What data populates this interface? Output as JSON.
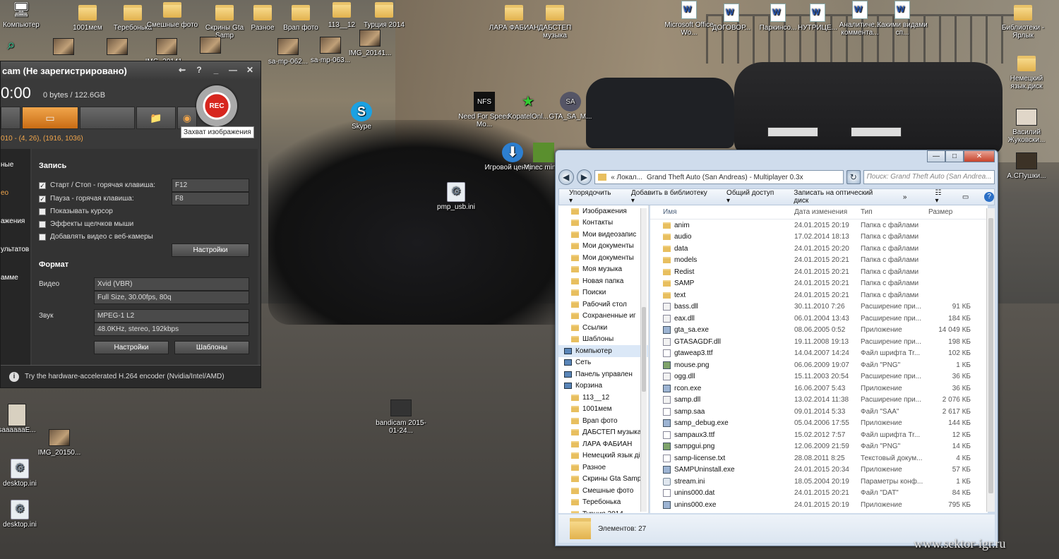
{
  "desktop": {
    "top_icons": [
      "Компьютер",
      "1001мем",
      "Теребонька",
      "Смешные фото",
      "Скрины Gta Samp",
      "Разное",
      "Врап фото",
      "113__12",
      "Турция 2014",
      "ЛАРА ФАБИАН",
      "ДАБСТЕП музыка",
      "Microsoft Office Wo...",
      "ДОГОВОР...",
      "Паркинсо...",
      "НУТРИЦЕ...",
      "Аналитиче... коммента...",
      "Какими видами сп...",
      "Библиотеки - Ярлык"
    ],
    "row2": [
      "IMG_20141...",
      "sa-mp-062...",
      "sa-mp-063...",
      "IMG_20141..."
    ],
    "mid_icons": [
      "Skype",
      "Need For Speed Mo...",
      "KopatelOnl...",
      "GTA_SA_M...",
      "Игровой центр ...",
      "Minec minec",
      "pmp_usb.ini"
    ],
    "right_icons": [
      "Немецкий язык.диск",
      "Василий Жуковски...",
      "А.СПушки..."
    ],
    "bottom_icons": [
      "saaaaaaE...",
      "IMG_20150...",
      "desktop.ini",
      "desktop.ini",
      "bandicam 2015-01-24..."
    ]
  },
  "bandicam": {
    "title": "cam (Не зарегистрировано)",
    "controls": [
      "⇜",
      "?",
      "_",
      "—",
      "✕"
    ],
    "timer": "0:00",
    "bytes": "0 bytes / 122.6GB",
    "rec": "REC",
    "tooltip": "Захват изображения",
    "coords": "010 - (4, 26), (1916, 1036)",
    "side": [
      "ные",
      "ео",
      "ажения",
      "ультатов",
      "амме"
    ],
    "rec_section": "Запись",
    "start_stop": "Старт / Стоп - горячая клавиша:",
    "start_key": "F12",
    "pause": "Пауза - горячая клавиша:",
    "pause_key": "F8",
    "show_cursor": "Показывать курсор",
    "mouse_fx": "Эффекты щелчков мыши",
    "webcam": "Добавлять видео с веб-камеры",
    "settings": "Настройки",
    "format": "Формат",
    "video_lbl": "Видео",
    "video_codec": "Xvid (VBR)",
    "video_params": "Full Size, 30.00fps, 80q",
    "audio_lbl": "Звук",
    "audio_codec": "MPEG-1 L2",
    "audio_params": "48.0KHz, stereo, 192kbps",
    "settings2": "Настройки",
    "templates": "Шаблоны",
    "hint": "Try the hardware-accelerated H.264 encoder (Nvidia/Intel/AMD)"
  },
  "explorer": {
    "path_start": "«  Локал...",
    "path": "Grand Theft Auto (San Andreas) - Multiplayer 0.3x",
    "search_placeholder": "Поиск: Grand Theft Auto (San Andrea...",
    "cmd": [
      "Упорядочить ▾",
      "Добавить в библиотеку ▾",
      "Общий доступ ▾",
      "Записать на оптический диск",
      "»"
    ],
    "tree": [
      "Изображения",
      "Контакты",
      "Мои видеозапис",
      "Мои документы",
      "Мои документы",
      "Моя музыка",
      "Новая папка",
      "Поиски",
      "Рабочий стол",
      "Сохраненные иг",
      "Ссылки",
      "Шаблоны",
      "Компьютер",
      "Сеть",
      "Панель управлен",
      "Корзина",
      "113__12",
      "1001мем",
      "Врап фото",
      "ДАБСТЕП музыка",
      "ЛАРА ФАБИАН",
      "Немецкий язык ді",
      "Разное",
      "Скрины Gta Samp",
      "Смешные фото",
      "Теребонька",
      "Турция 2014"
    ],
    "headers": [
      "Имя",
      "Дата изменения",
      "Тип",
      "Размер"
    ],
    "files": [
      [
        "anim",
        "24.01.2015 20:19",
        "Папка с файлами",
        "",
        "folder"
      ],
      [
        "audio",
        "17.02.2014 18:13",
        "Папка с файлами",
        "",
        "folder"
      ],
      [
        "data",
        "24.01.2015 20:20",
        "Папка с файлами",
        "",
        "folder"
      ],
      [
        "models",
        "24.01.2015 20:21",
        "Папка с файлами",
        "",
        "folder"
      ],
      [
        "Redist",
        "24.01.2015 20:21",
        "Папка с файлами",
        "",
        "folder"
      ],
      [
        "SAMP",
        "24.01.2015 20:21",
        "Папка с файлами",
        "",
        "folder"
      ],
      [
        "text",
        "24.01.2015 20:21",
        "Папка с файлами",
        "",
        "folder"
      ],
      [
        "bass.dll",
        "30.11.2010 7:26",
        "Расширение при...",
        "91 КБ",
        "dll"
      ],
      [
        "eax.dll",
        "06.01.2004 13:43",
        "Расширение при...",
        "184 КБ",
        "dll"
      ],
      [
        "gta_sa.exe",
        "08.06.2005 0:52",
        "Приложение",
        "14 049 КБ",
        "exe"
      ],
      [
        "GTASAGDF.dll",
        "19.11.2008 19:13",
        "Расширение при...",
        "198 КБ",
        "dll"
      ],
      [
        "gtaweap3.ttf",
        "14.04.2007 14:24",
        "Файл шрифта Tr...",
        "102 КБ",
        "doc"
      ],
      [
        "mouse.png",
        "06.06.2009 19:07",
        "Файл \"PNG\"",
        "1 КБ",
        "img"
      ],
      [
        "ogg.dll",
        "15.11.2003 20:54",
        "Расширение при...",
        "36 КБ",
        "dll"
      ],
      [
        "rcon.exe",
        "16.06.2007 5:43",
        "Приложение",
        "36 КБ",
        "exe"
      ],
      [
        "samp.dll",
        "13.02.2014 11:38",
        "Расширение при...",
        "2 076 КБ",
        "dll"
      ],
      [
        "samp.saa",
        "09.01.2014 5:33",
        "Файл \"SAA\"",
        "2 617 КБ",
        "doc"
      ],
      [
        "samp_debug.exe",
        "05.04.2006 17:55",
        "Приложение",
        "144 КБ",
        "exe"
      ],
      [
        "sampaux3.ttf",
        "15.02.2012 7:57",
        "Файл шрифта Tr...",
        "12 КБ",
        "doc"
      ],
      [
        "sampgui.png",
        "12.06.2009 21:59",
        "Файл \"PNG\"",
        "14 КБ",
        "img"
      ],
      [
        "samp-license.txt",
        "28.08.2011 8:25",
        "Текстовый докум...",
        "4 КБ",
        "doc"
      ],
      [
        "SAMPUninstall.exe",
        "24.01.2015 20:34",
        "Приложение",
        "57 КБ",
        "exe"
      ],
      [
        "stream.ini",
        "18.05.2004 20:19",
        "Параметры конф...",
        "1 КБ",
        "gear"
      ],
      [
        "unins000.dat",
        "24.01.2015 20:21",
        "Файл \"DAT\"",
        "84 КБ",
        "doc"
      ],
      [
        "unins000.exe",
        "24.01.2015 20:19",
        "Приложение",
        "795 КБ",
        "exe"
      ]
    ],
    "status": "Элементов: 27"
  },
  "watermark": "www.sektor-igr.ru"
}
